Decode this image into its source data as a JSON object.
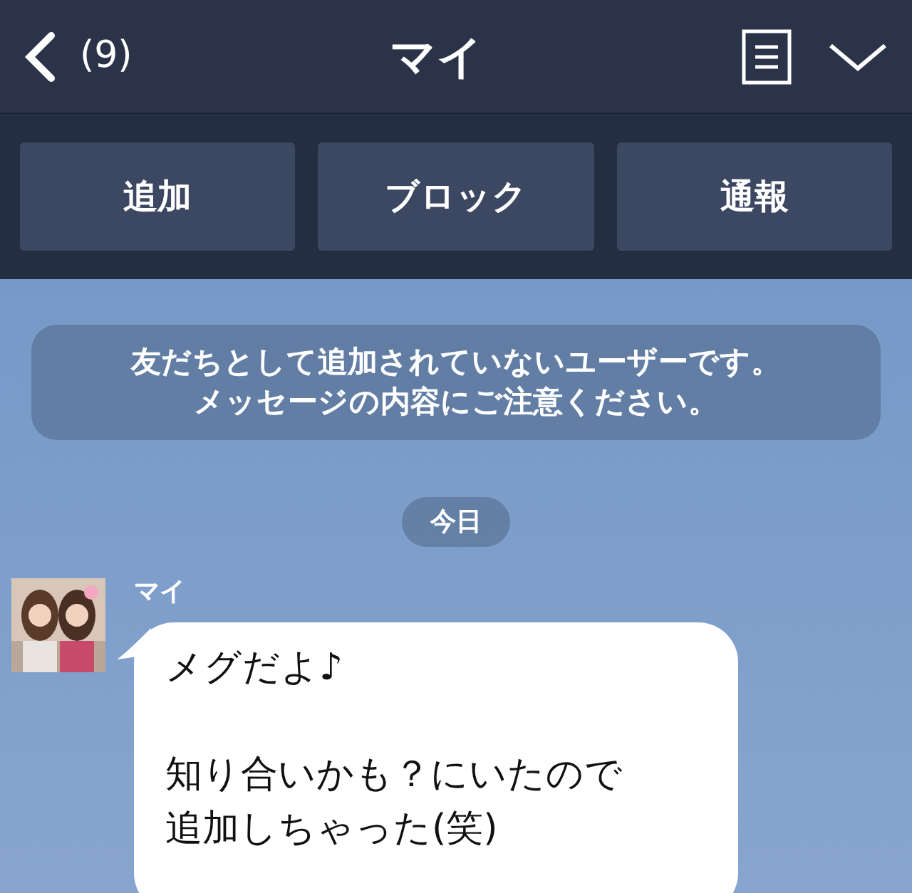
{
  "header": {
    "back_count": "(9)",
    "title": "マイ"
  },
  "actions": [
    {
      "label": "追加"
    },
    {
      "label": "ブロック"
    },
    {
      "label": "通報"
    }
  ],
  "notice": [
    "友だちとして追加されていないユーザーです。",
    "メッセージの内容にご注意ください。"
  ],
  "date": "今日",
  "messages": [
    {
      "sender": "マイ",
      "avatar": {
        "kind": "picture"
      },
      "paragraphs": [
        {
          "lines": [
            "メグだよ♪"
          ]
        },
        {
          "lines": [
            "知り合いかも？にいたので",
            "追加しちゃった(笑)"
          ]
        }
      ]
    }
  ]
}
